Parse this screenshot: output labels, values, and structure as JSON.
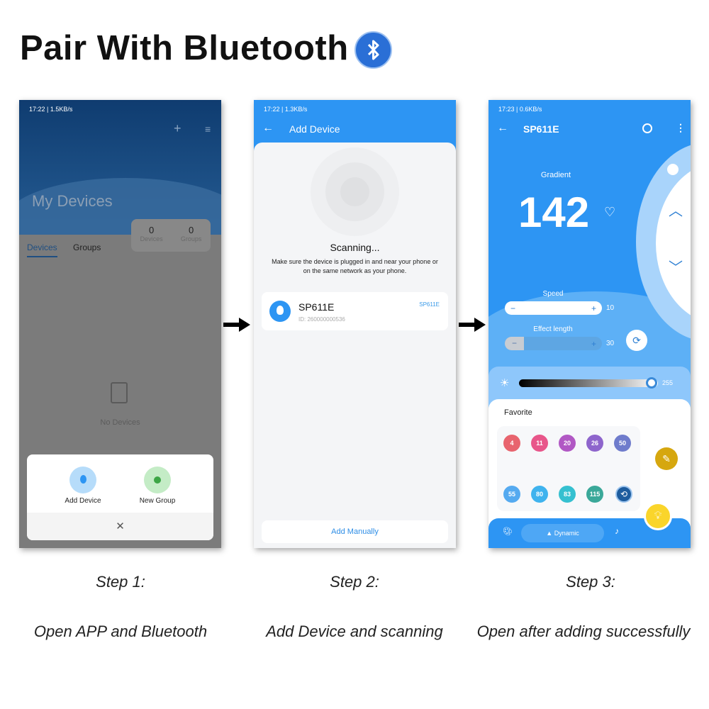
{
  "title": "Pair With Bluetooth",
  "bluetooth_icon": "bluetooth-icon",
  "steps": [
    {
      "label": "Step 1:",
      "desc": "Open APP and Bluetooth"
    },
    {
      "label": "Step 2:",
      "desc": "Add Device and scanning"
    },
    {
      "label": "Step 3:",
      "desc": "Open after adding successfully"
    }
  ],
  "phone1": {
    "status": "17:22 | 1.5KB/s",
    "title": "My Devices",
    "tabs": [
      "Devices",
      "Groups"
    ],
    "stats": [
      {
        "value": "0",
        "label": "Devices"
      },
      {
        "value": "0",
        "label": "Groups"
      }
    ],
    "empty": "No Devices",
    "sheet": {
      "add_device": "Add Device",
      "new_group": "New Group"
    }
  },
  "phone2": {
    "status": "17:22 | 1.3KB/s",
    "title": "Add Device",
    "scanning": "Scanning...",
    "hint": "Make sure the device is plugged in and near your phone or on the same network as your phone.",
    "device": {
      "name": "SP611E",
      "id": "ID: 260000000536",
      "tag": "SP611E"
    },
    "add_manually": "Add Manually"
  },
  "phone3": {
    "status": "17:23 | 0.6KB/s",
    "title": "SP611E",
    "mode": "Gradient",
    "number": "142",
    "speed": {
      "label": "Speed",
      "value": "10"
    },
    "effect_length": {
      "label": "Effect length",
      "value": "30"
    },
    "brightness": "255",
    "favorite_label": "Favorite",
    "favorites": [
      {
        "n": "4",
        "color": "#e8646e"
      },
      {
        "n": "11",
        "color": "#e8568a"
      },
      {
        "n": "20",
        "color": "#b158c4"
      },
      {
        "n": "26",
        "color": "#8e65cc"
      },
      {
        "n": "50",
        "color": "#6f7ccc"
      },
      {
        "n": "55",
        "color": "#55aaf0"
      },
      {
        "n": "80",
        "color": "#3fb3ee"
      },
      {
        "n": "83",
        "color": "#35c0d0"
      },
      {
        "n": "115",
        "color": "#3aa899"
      }
    ],
    "nav_dynamic": "Dynamic"
  }
}
